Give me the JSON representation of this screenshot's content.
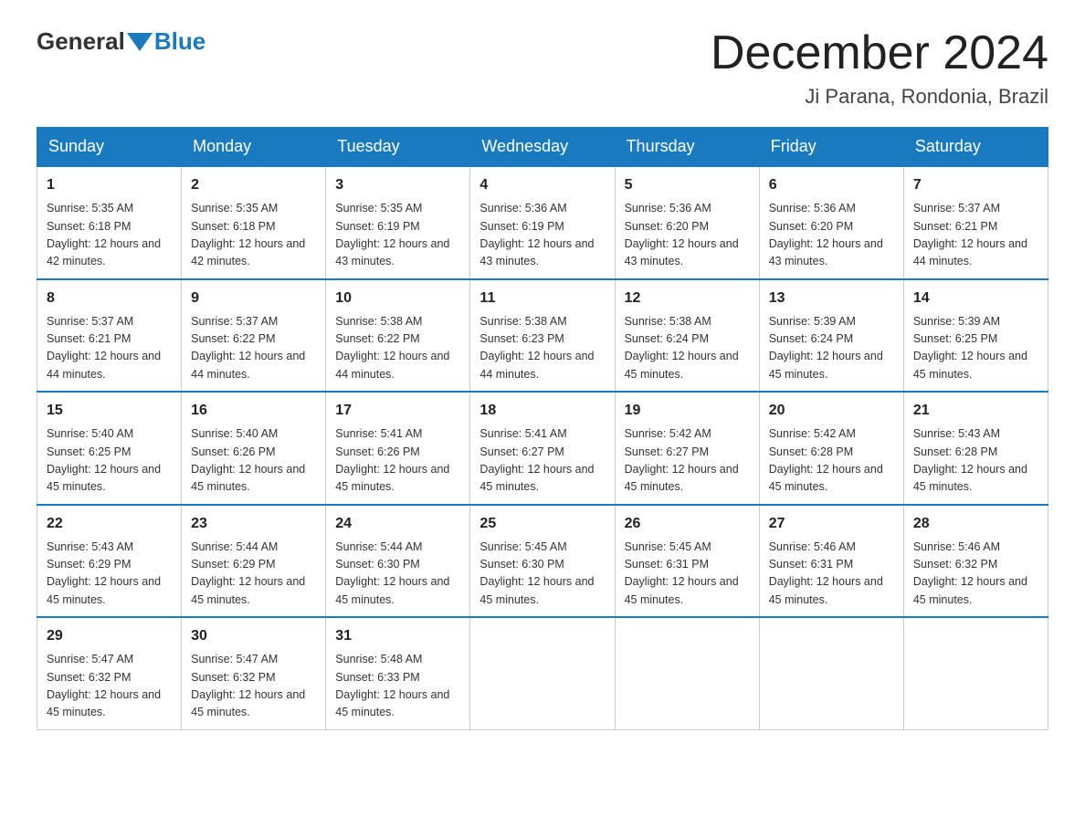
{
  "header": {
    "logo_general": "General",
    "logo_blue": "Blue",
    "month_title": "December 2024",
    "location": "Ji Parana, Rondonia, Brazil"
  },
  "days_of_week": [
    "Sunday",
    "Monday",
    "Tuesday",
    "Wednesday",
    "Thursday",
    "Friday",
    "Saturday"
  ],
  "weeks": [
    [
      {
        "day": "1",
        "sunrise": "5:35 AM",
        "sunset": "6:18 PM",
        "daylight": "12 hours and 42 minutes."
      },
      {
        "day": "2",
        "sunrise": "5:35 AM",
        "sunset": "6:18 PM",
        "daylight": "12 hours and 42 minutes."
      },
      {
        "day": "3",
        "sunrise": "5:35 AM",
        "sunset": "6:19 PM",
        "daylight": "12 hours and 43 minutes."
      },
      {
        "day": "4",
        "sunrise": "5:36 AM",
        "sunset": "6:19 PM",
        "daylight": "12 hours and 43 minutes."
      },
      {
        "day": "5",
        "sunrise": "5:36 AM",
        "sunset": "6:20 PM",
        "daylight": "12 hours and 43 minutes."
      },
      {
        "day": "6",
        "sunrise": "5:36 AM",
        "sunset": "6:20 PM",
        "daylight": "12 hours and 43 minutes."
      },
      {
        "day": "7",
        "sunrise": "5:37 AM",
        "sunset": "6:21 PM",
        "daylight": "12 hours and 44 minutes."
      }
    ],
    [
      {
        "day": "8",
        "sunrise": "5:37 AM",
        "sunset": "6:21 PM",
        "daylight": "12 hours and 44 minutes."
      },
      {
        "day": "9",
        "sunrise": "5:37 AM",
        "sunset": "6:22 PM",
        "daylight": "12 hours and 44 minutes."
      },
      {
        "day": "10",
        "sunrise": "5:38 AM",
        "sunset": "6:22 PM",
        "daylight": "12 hours and 44 minutes."
      },
      {
        "day": "11",
        "sunrise": "5:38 AM",
        "sunset": "6:23 PM",
        "daylight": "12 hours and 44 minutes."
      },
      {
        "day": "12",
        "sunrise": "5:38 AM",
        "sunset": "6:24 PM",
        "daylight": "12 hours and 45 minutes."
      },
      {
        "day": "13",
        "sunrise": "5:39 AM",
        "sunset": "6:24 PM",
        "daylight": "12 hours and 45 minutes."
      },
      {
        "day": "14",
        "sunrise": "5:39 AM",
        "sunset": "6:25 PM",
        "daylight": "12 hours and 45 minutes."
      }
    ],
    [
      {
        "day": "15",
        "sunrise": "5:40 AM",
        "sunset": "6:25 PM",
        "daylight": "12 hours and 45 minutes."
      },
      {
        "day": "16",
        "sunrise": "5:40 AM",
        "sunset": "6:26 PM",
        "daylight": "12 hours and 45 minutes."
      },
      {
        "day": "17",
        "sunrise": "5:41 AM",
        "sunset": "6:26 PM",
        "daylight": "12 hours and 45 minutes."
      },
      {
        "day": "18",
        "sunrise": "5:41 AM",
        "sunset": "6:27 PM",
        "daylight": "12 hours and 45 minutes."
      },
      {
        "day": "19",
        "sunrise": "5:42 AM",
        "sunset": "6:27 PM",
        "daylight": "12 hours and 45 minutes."
      },
      {
        "day": "20",
        "sunrise": "5:42 AM",
        "sunset": "6:28 PM",
        "daylight": "12 hours and 45 minutes."
      },
      {
        "day": "21",
        "sunrise": "5:43 AM",
        "sunset": "6:28 PM",
        "daylight": "12 hours and 45 minutes."
      }
    ],
    [
      {
        "day": "22",
        "sunrise": "5:43 AM",
        "sunset": "6:29 PM",
        "daylight": "12 hours and 45 minutes."
      },
      {
        "day": "23",
        "sunrise": "5:44 AM",
        "sunset": "6:29 PM",
        "daylight": "12 hours and 45 minutes."
      },
      {
        "day": "24",
        "sunrise": "5:44 AM",
        "sunset": "6:30 PM",
        "daylight": "12 hours and 45 minutes."
      },
      {
        "day": "25",
        "sunrise": "5:45 AM",
        "sunset": "6:30 PM",
        "daylight": "12 hours and 45 minutes."
      },
      {
        "day": "26",
        "sunrise": "5:45 AM",
        "sunset": "6:31 PM",
        "daylight": "12 hours and 45 minutes."
      },
      {
        "day": "27",
        "sunrise": "5:46 AM",
        "sunset": "6:31 PM",
        "daylight": "12 hours and 45 minutes."
      },
      {
        "day": "28",
        "sunrise": "5:46 AM",
        "sunset": "6:32 PM",
        "daylight": "12 hours and 45 minutes."
      }
    ],
    [
      {
        "day": "29",
        "sunrise": "5:47 AM",
        "sunset": "6:32 PM",
        "daylight": "12 hours and 45 minutes."
      },
      {
        "day": "30",
        "sunrise": "5:47 AM",
        "sunset": "6:32 PM",
        "daylight": "12 hours and 45 minutes."
      },
      {
        "day": "31",
        "sunrise": "5:48 AM",
        "sunset": "6:33 PM",
        "daylight": "12 hours and 45 minutes."
      },
      null,
      null,
      null,
      null
    ]
  ]
}
